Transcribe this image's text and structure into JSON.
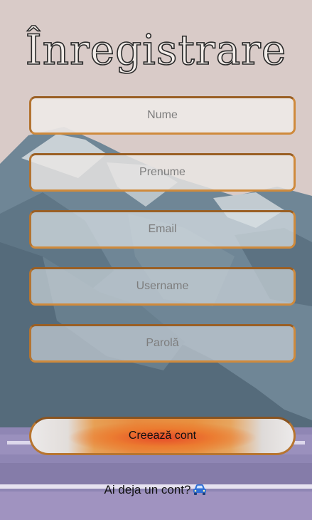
{
  "page": {
    "title": "Înregistrare"
  },
  "form": {
    "fields": [
      {
        "name": "nume",
        "placeholder": "Nume",
        "value": ""
      },
      {
        "name": "prenume",
        "placeholder": "Prenume",
        "value": ""
      },
      {
        "name": "email",
        "placeholder": "Email",
        "value": ""
      },
      {
        "name": "username",
        "placeholder": "Username",
        "value": ""
      },
      {
        "name": "parola",
        "placeholder": "Parolă",
        "value": ""
      }
    ],
    "submit_label": "Creează cont"
  },
  "footer": {
    "login_text": "Ai deja un cont?",
    "login_icon": "car-icon"
  },
  "colors": {
    "accent_border": "#cf8a3c",
    "background": "#d9cbc8"
  }
}
